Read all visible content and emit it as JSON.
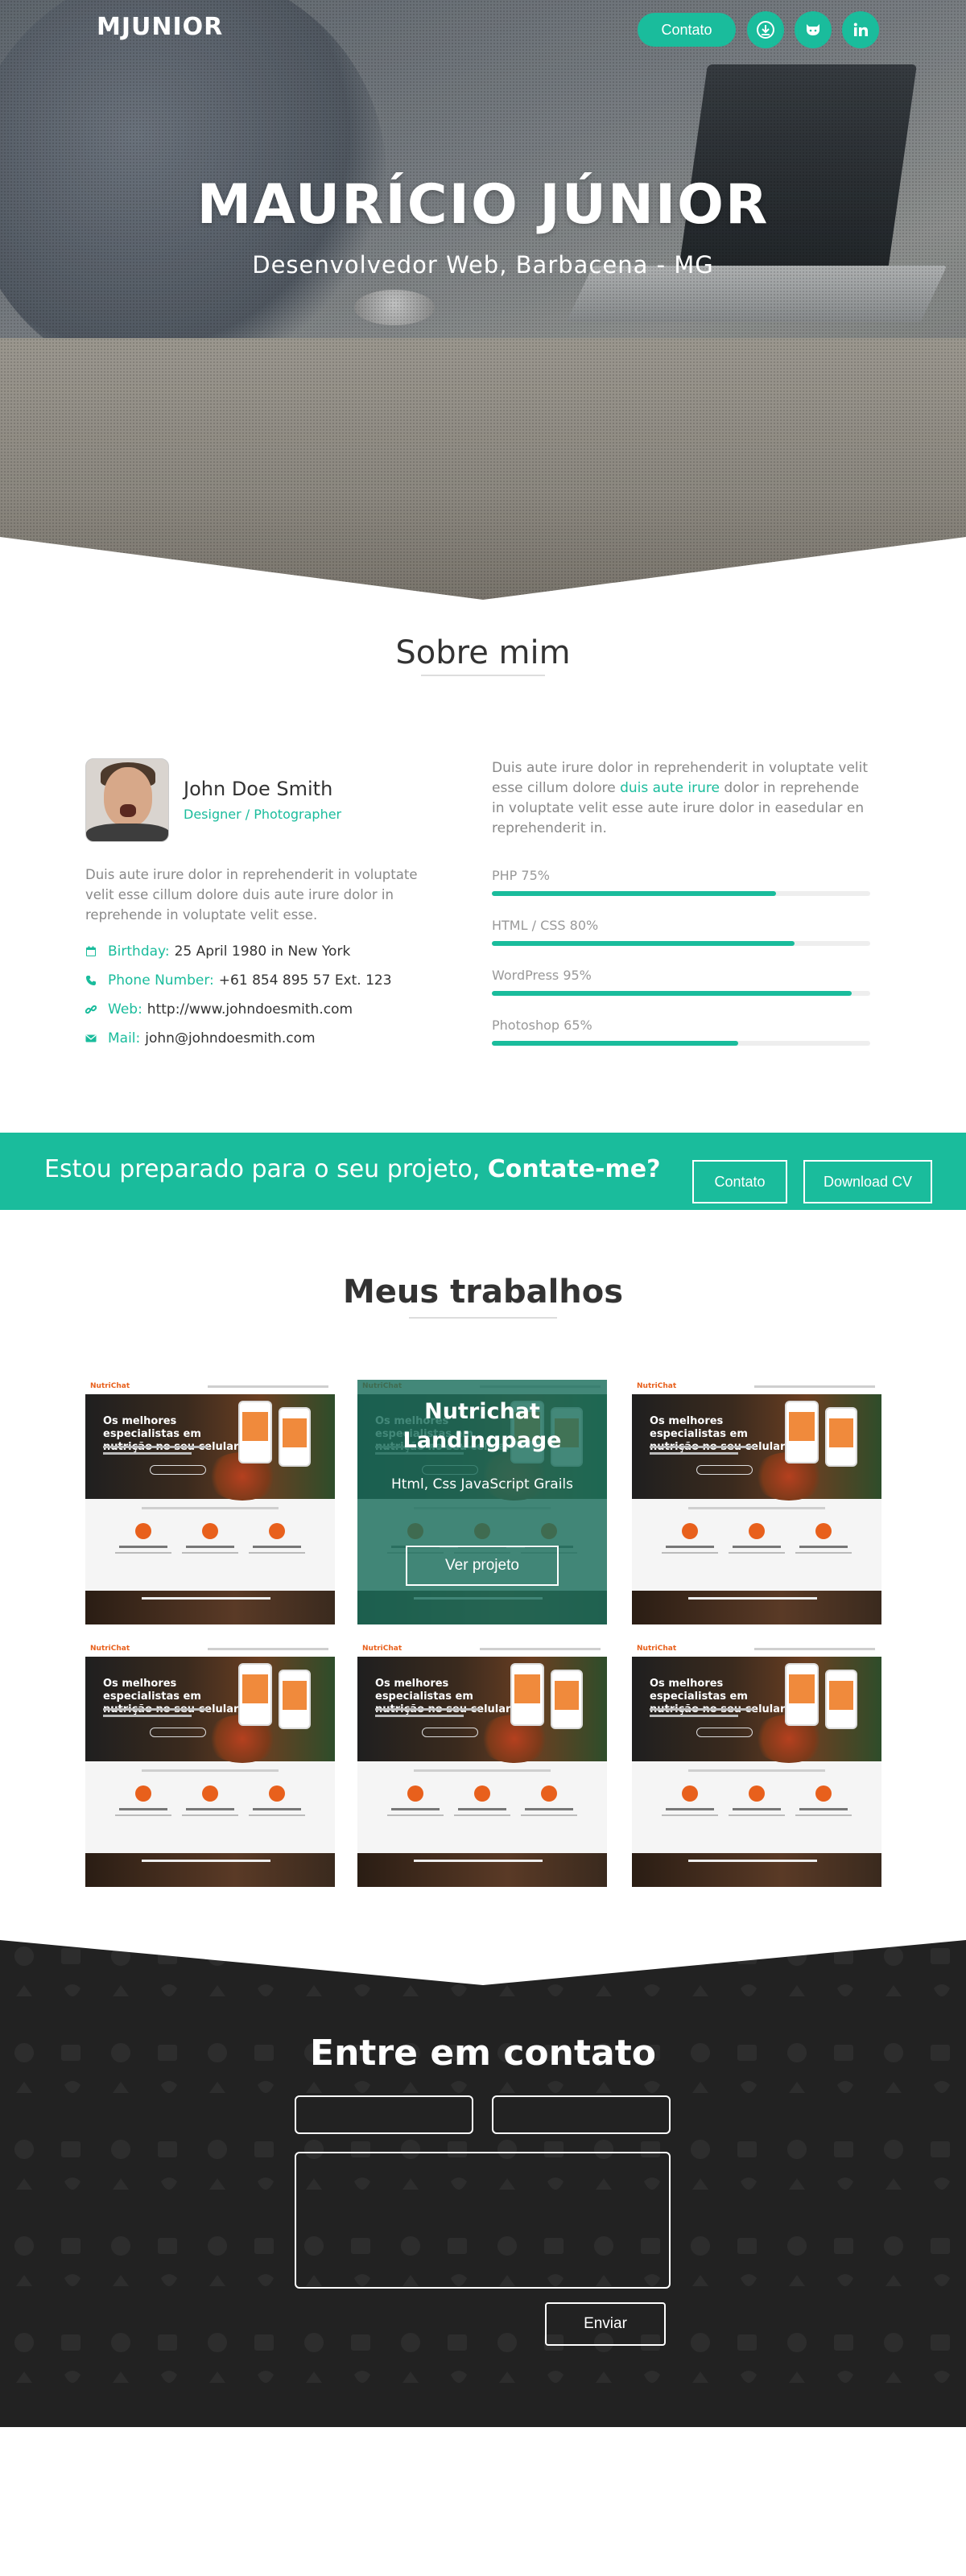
{
  "header": {
    "logo": "MJUNIOR",
    "contact_button": "Contato",
    "icons": [
      "download-icon",
      "github-icon",
      "linkedin-icon"
    ]
  },
  "hero": {
    "title": "MAURÍCIO JÚNIOR",
    "subtitle": "Desenvolvedor Web, Barbacena - MG"
  },
  "about": {
    "section_title": "Sobre mim",
    "name": "John Doe Smith",
    "role": "Designer / Photographer",
    "bio": "Duis aute irure dolor in reprehenderit in voluptate velit esse cillum dolore duis aute irure dolor in reprehende in voluptate velit esse.",
    "info": [
      {
        "icon": "calendar-icon",
        "label": "Birthday:",
        "value": "25 April 1980 in New York"
      },
      {
        "icon": "phone-icon",
        "label": "Phone Number:",
        "value": "+61 854 895 57 Ext. 123"
      },
      {
        "icon": "link-icon",
        "label": "Web:",
        "value": "http://www.johndoesmith.com"
      },
      {
        "icon": "mail-icon",
        "label": "Mail:",
        "value": "john@johndoesmith.com"
      }
    ],
    "text_before": "Duis aute irure dolor in reprehenderit in voluptate velit esse cillum dolore ",
    "text_highlight": "duis aute irure",
    "text_after": " dolor in reprehende in voluptate velit esse aute irure dolor in easedular en reprehenderit in.",
    "skills": [
      {
        "label": "PHP 75%",
        "value": 0.75
      },
      {
        "label": "HTML / CSS 80%",
        "value": 0.8
      },
      {
        "label": "WordPress 95%",
        "value": 0.95
      },
      {
        "label": "Photoshop 65%",
        "value": 0.65
      }
    ]
  },
  "cta": {
    "text": "Estou preparado para o seu projeto, ",
    "text_bold": "Contate-me?",
    "contact_button": "Contato",
    "cv_button": "Download CV"
  },
  "works": {
    "section_title": "Meus trabalhos",
    "thumb_logo": "NutriChat",
    "thumb_headline": "Os melhores especialistas em nutrição no seu celular",
    "featured": {
      "title": "Nutrichat Landingpage",
      "tech": "Html, Css JavaScript Grails",
      "button": "Ver projeto"
    }
  },
  "contact": {
    "title": "Entre em contato",
    "send_button": "Enviar"
  },
  "colors": {
    "accent": "#1abc9c",
    "dark": "#222222"
  }
}
